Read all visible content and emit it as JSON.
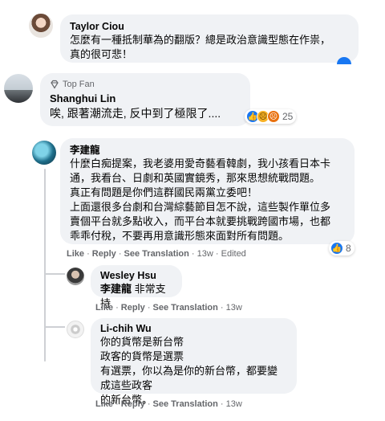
{
  "comments": [
    {
      "author": "Taylor Ciou",
      "text": "怎麼有一種抵制華為的翻版？總是政治意識型態在作祟，\n真的很可悲！"
    },
    {
      "badge": "Top Fan",
      "author": "Shanghui Lin",
      "text": "唉, 跟著潮流走, 反中到了極限了....",
      "reactions": {
        "icons": [
          "like-icon",
          "sad-icon",
          "angry-icon"
        ],
        "count": "25"
      }
    },
    {
      "author": "李建龍",
      "text": "什麼白痴提案，我老婆用愛奇藝看韓劇，我小孩看日本卡\n通，我看台、日劇和英國實鏡秀，那來思想統戰問題。\n真正有問題是你們這群國民兩黨立委吧！\n上面還很多台劇和台灣綜藝節目怎不說，這些製作單位多\n賣個平台就多點收入，而平台本就要挑戰跨國市場，也都\n乖乖付稅，不要再用意識形態來面對所有問題。",
      "actions": {
        "like": "Like",
        "reply": "Reply",
        "translate": "See Translation",
        "time": "13w",
        "edited": "Edited"
      },
      "reactions": {
        "icons": [
          "like-icon"
        ],
        "count": "8"
      }
    },
    {
      "author": "Wesley Hsu",
      "mention": "李建龍",
      "text": "非常支持",
      "actions": {
        "like": "Like",
        "reply": "Reply",
        "translate": "See Translation",
        "time": "13w"
      }
    },
    {
      "author": "Li-chih Wu",
      "text": "你的貨幣是新台幣\n政客的貨幣是選票\n有選票，你以為是你的新台幣，都要變成這些政客\n的新台幣。",
      "actions": {
        "like": "Like",
        "reply": "Reply",
        "translate": "See Translation",
        "time": "13w"
      }
    }
  ],
  "colors": {
    "bubble": "#f0f2f5",
    "meta": "#65676b",
    "like": "#1877f2"
  }
}
